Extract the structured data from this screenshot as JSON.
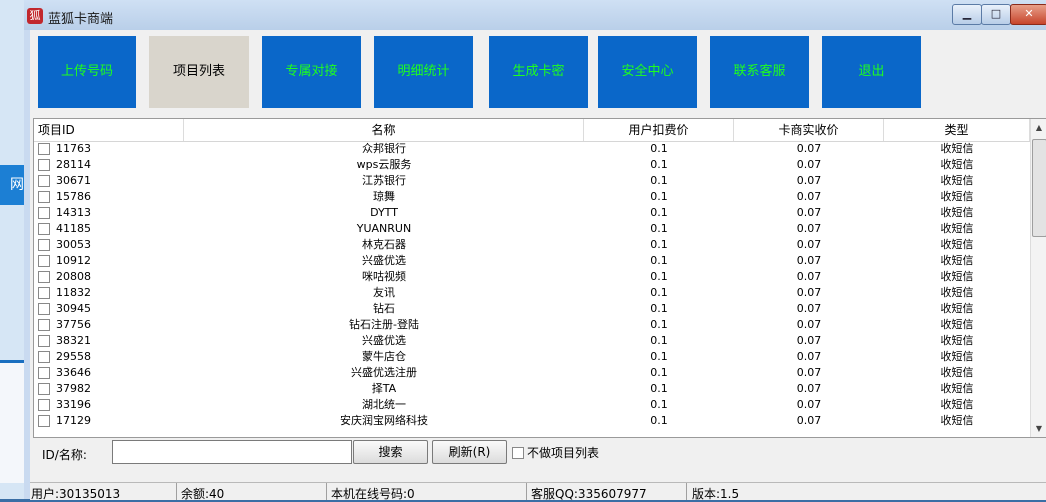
{
  "window": {
    "title": "蓝狐卡商端",
    "icon": "fox-icon",
    "min_label": "▁",
    "max_label": "□",
    "close_label": "✕"
  },
  "desktop": {
    "left_label": "网"
  },
  "nav": [
    {
      "label": "上传号码",
      "active": false
    },
    {
      "label": "项目列表",
      "active": true
    },
    {
      "label": "专属对接",
      "active": false
    },
    {
      "label": "明细统计",
      "active": false
    },
    {
      "label": "生成卡密",
      "active": false
    },
    {
      "label": "安全中心",
      "active": false
    },
    {
      "label": "联系客服",
      "active": false
    },
    {
      "label": "退出",
      "active": false
    }
  ],
  "table": {
    "columns": [
      "项目ID",
      "名称",
      "用户扣费价",
      "卡商实收价",
      "类型"
    ],
    "rows": [
      [
        "11763",
        "众邦银行",
        "0.1",
        "0.07",
        "收短信"
      ],
      [
        "28114",
        "wps云服务",
        "0.1",
        "0.07",
        "收短信"
      ],
      [
        "30671",
        "江苏银行",
        "0.1",
        "0.07",
        "收短信"
      ],
      [
        "15786",
        "琼舞",
        "0.1",
        "0.07",
        "收短信"
      ],
      [
        "14313",
        "DYTT",
        "0.1",
        "0.07",
        "收短信"
      ],
      [
        "41185",
        "YUANRUN",
        "0.1",
        "0.07",
        "收短信"
      ],
      [
        "30053",
        "林克石器",
        "0.1",
        "0.07",
        "收短信"
      ],
      [
        "10912",
        "兴盛优选",
        "0.1",
        "0.07",
        "收短信"
      ],
      [
        "20808",
        "咪咕视频",
        "0.1",
        "0.07",
        "收短信"
      ],
      [
        "11832",
        "友讯",
        "0.1",
        "0.07",
        "收短信"
      ],
      [
        "30945",
        "钻石",
        "0.1",
        "0.07",
        "收短信"
      ],
      [
        "37756",
        "钻石注册-登陆",
        "0.1",
        "0.07",
        "收短信"
      ],
      [
        "38321",
        "兴盛优选",
        "0.1",
        "0.07",
        "收短信"
      ],
      [
        "29558",
        "蒙牛店仓",
        "0.1",
        "0.07",
        "收短信"
      ],
      [
        "33646",
        "兴盛优选注册",
        "0.1",
        "0.07",
        "收短信"
      ],
      [
        "37982",
        "择TA",
        "0.1",
        "0.07",
        "收短信"
      ],
      [
        "33196",
        "湖北统一",
        "0.1",
        "0.07",
        "收短信"
      ],
      [
        "17129",
        "安庆润宝网络科技",
        "0.1",
        "0.07",
        "收短信"
      ]
    ]
  },
  "search": {
    "label": "ID/名称:",
    "value": "",
    "search_button": "搜索",
    "refresh_button": "刷新(R)",
    "exclude_label": "不做项目列表"
  },
  "status": {
    "user": "用户:30135013",
    "balance": "余额:40",
    "online": "本机在线号码:0",
    "qq": "客服QQ:335607977",
    "version": "版本:1.5"
  },
  "colors": {
    "nav_bg": "#0a67c9",
    "nav_text": "#1eff1e",
    "nav_active_bg": "#d9d5cc"
  }
}
